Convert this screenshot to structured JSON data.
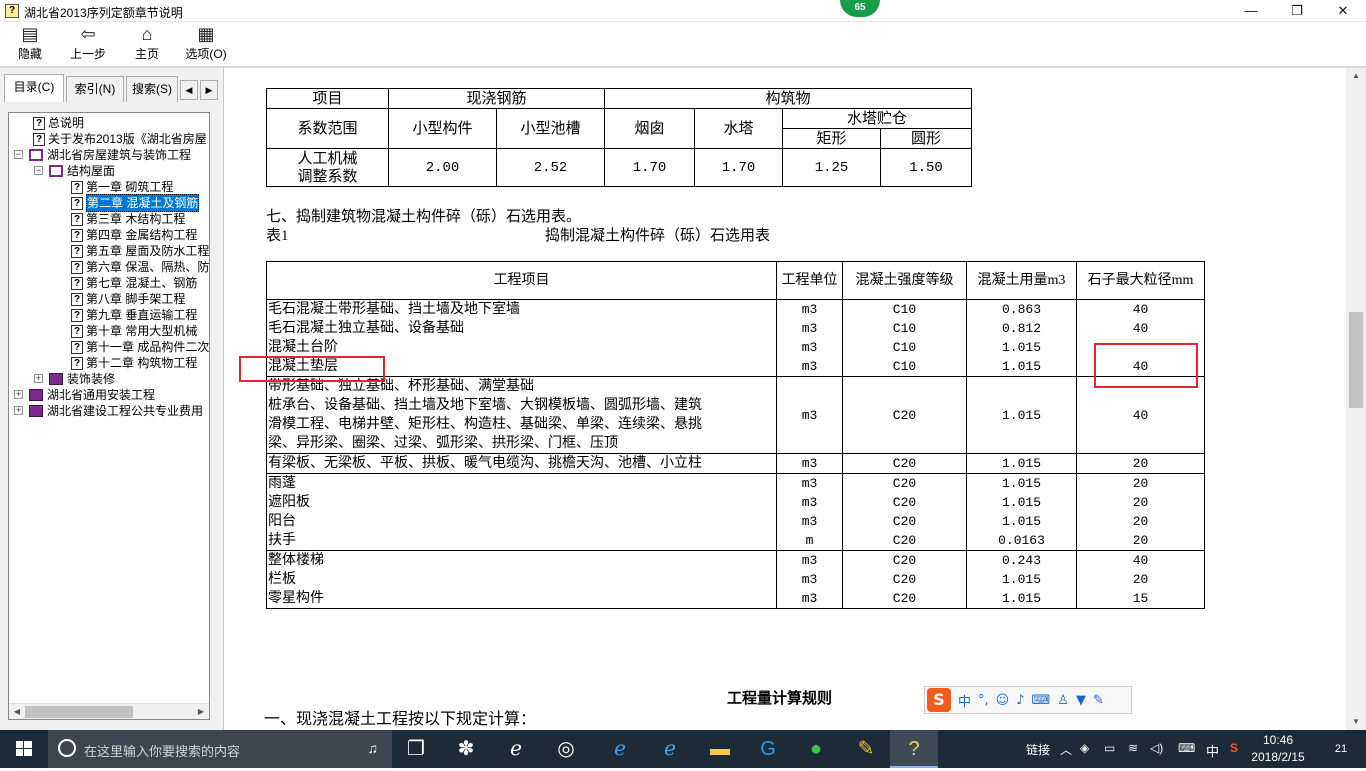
{
  "window": {
    "title": "湖北省2013序列定额章节说明",
    "icon": "help-doc-icon",
    "badge": "65",
    "minimize": "—",
    "maximize": "❐",
    "close": "✕"
  },
  "toolbar": {
    "hide": "隐藏",
    "back": "上一步",
    "home": "主页",
    "options": "选项(O)"
  },
  "tabs": {
    "contents": "目录(C)",
    "index": "索引(N)",
    "search": "搜索(S)"
  },
  "tree": [
    {
      "label": "总说明",
      "type": "page"
    },
    {
      "label": "关于发布2013版《湖北省房屋",
      "type": "page"
    },
    {
      "label": "湖北省房屋建筑与装饰工程",
      "type": "book-open"
    },
    {
      "label": "结构屋面",
      "type": "book-open"
    },
    {
      "label": "第一章  砌筑工程",
      "type": "page"
    },
    {
      "label": "第二章  混凝土及钢筋",
      "type": "page",
      "selected": true
    },
    {
      "label": "第三章  木结构工程",
      "type": "page"
    },
    {
      "label": "第四章  金属结构工程",
      "type": "page"
    },
    {
      "label": "第五章  屋面及防水工程",
      "type": "page"
    },
    {
      "label": "第六章  保温、隔热、防",
      "type": "page"
    },
    {
      "label": "第七章  混凝土、钢筋",
      "type": "page"
    },
    {
      "label": "第八章  脚手架工程",
      "type": "page"
    },
    {
      "label": "第九章  垂直运输工程",
      "type": "page"
    },
    {
      "label": "第十章  常用大型机械",
      "type": "page"
    },
    {
      "label": "第十一章  成品构件二次",
      "type": "page"
    },
    {
      "label": "第十二章  构筑物工程",
      "type": "page"
    },
    {
      "label": "装饰装修",
      "type": "book"
    },
    {
      "label": "湖北省通用安装工程",
      "type": "book"
    },
    {
      "label": "湖北省建设工程公共专业费用",
      "type": "book"
    }
  ],
  "table1": {
    "h_item": "项目",
    "h_cast": "现浇钢筋",
    "h_struct": "构筑物",
    "h_range": "系数范围",
    "h_small": "小型构件",
    "h_pool": "小型池槽",
    "h_chimney": "烟囱",
    "h_tower": "水塔",
    "h_silo": "水塔贮仓",
    "h_rect": "矩形",
    "h_round": "圆形",
    "row_label_1": "人工机械",
    "row_label_2": "调整系数",
    "values": [
      "2.00",
      "2.52",
      "1.70",
      "1.70",
      "1.25",
      "1.50"
    ]
  },
  "section7": {
    "heading": "七、捣制建筑物混凝土构件碎（砾）石选用表。",
    "table_no": "表1",
    "table_title": "捣制混凝土构件碎（砾）石选用表"
  },
  "table2": {
    "headers": [
      "工程项目",
      "工程单位",
      "混凝土强度等级",
      "混凝土用量m3",
      "石子最大粒径mm"
    ],
    "groups": [
      {
        "items": [
          "毛石混凝土带形基础、挡土墙及地下室墙",
          "毛石混凝土独立基础、设备基础",
          "混凝土台阶",
          "混凝土垫层"
        ],
        "units": [
          "m3",
          "m3",
          "m3",
          "m3"
        ],
        "grades": [
          "C10",
          "C10",
          "C10",
          "C10"
        ],
        "amounts": [
          "0.863",
          "0.812",
          "1.015",
          "1.015"
        ],
        "sizes": [
          "40",
          "40",
          "",
          "40"
        ]
      },
      {
        "items": [
          "带形基础、独立基础、杯形基础、满堂基础",
          "桩承台、设备基础、挡土墙及地下室墙、大钢模板墙、圆弧形墙、建筑",
          "滑模工程、电梯井壁、矩形柱、构造柱、基础梁、单梁、连续梁、悬挑",
          "梁、异形梁、圈梁、过梁、弧形梁、拱形梁、门框、压顶"
        ],
        "units": [
          "m3"
        ],
        "grades": [
          "C20"
        ],
        "amounts": [
          "1.015"
        ],
        "sizes": [
          "40"
        ]
      },
      {
        "items": [
          "有梁板、无梁板、平板、拱板、暖气电缆沟、挑檐天沟、池槽、小立柱"
        ],
        "units": [
          "m3"
        ],
        "grades": [
          "C20"
        ],
        "amounts": [
          "1.015"
        ],
        "sizes": [
          "20"
        ]
      },
      {
        "items": [
          "雨蓬",
          "遮阳板",
          "阳台",
          "扶手"
        ],
        "units": [
          "m3",
          "m3",
          "m3",
          "m"
        ],
        "grades": [
          "C20",
          "C20",
          "C20",
          "C20"
        ],
        "amounts": [
          "1.015",
          "1.015",
          "1.015",
          "0.0163"
        ],
        "sizes": [
          "20",
          "20",
          "20",
          "20"
        ]
      },
      {
        "items": [
          "整体楼梯",
          "栏板",
          "零星构件"
        ],
        "units": [
          "m3",
          "m3",
          "m3"
        ],
        "grades": [
          "C20",
          "C20",
          "C20"
        ],
        "amounts": [
          "0.243",
          "1.015",
          "1.015"
        ],
        "sizes": [
          "40",
          "20",
          "15"
        ]
      }
    ]
  },
  "rules": {
    "title": "工程量计算规则",
    "first_line": "一、现浇混凝土工程按以下规定计算："
  },
  "ime": {
    "logo": "S",
    "lang": "中",
    "icons": [
      "punct-icon",
      "emoji-icon",
      "voice-icon",
      "keyboard-icon",
      "user-icon",
      "skin-icon",
      "settings-icon"
    ]
  },
  "taskbar": {
    "search_placeholder": "在这里输入你要搜索的内容",
    "tray_link": "链接",
    "tray_lang": "中",
    "time": "10:46",
    "date": "2018/2/15",
    "notif": "21"
  }
}
